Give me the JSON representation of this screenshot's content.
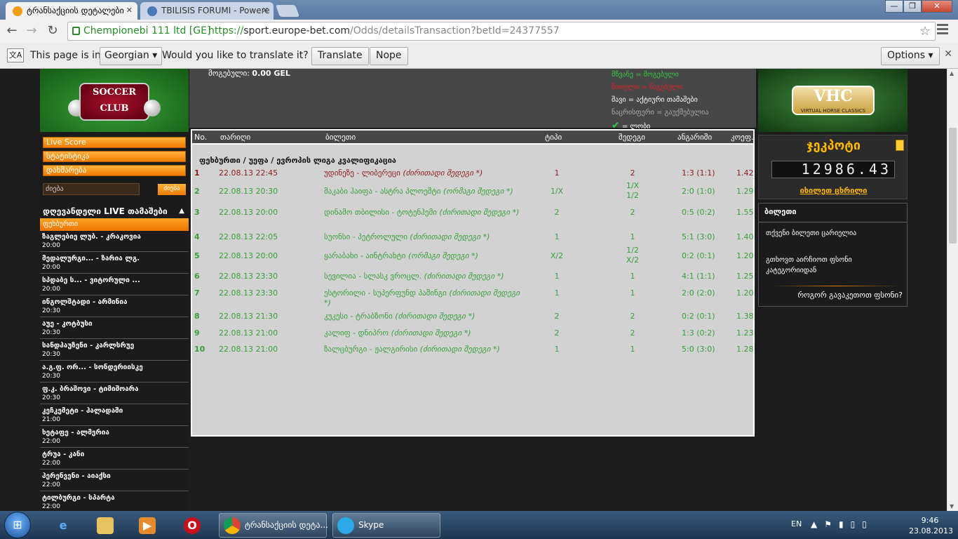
{
  "browser": {
    "tabs": [
      {
        "title": "ტრანსაქციის დეტალები",
        "active": true
      },
      {
        "title": "TBILISIS FORUMI - Powere",
        "active": false
      }
    ],
    "cert": "Chempionebi 111 ltd [GE]",
    "url_scheme": "https://",
    "url_host": "sport.europe-bet.com",
    "url_path": "/Odds/detailsTransaction?betId=24377557",
    "translate": {
      "prefix": "This page is in",
      "language": "Georgian",
      "question": "Would you like to translate it?",
      "translate_btn": "Translate",
      "nope_btn": "Nope",
      "options_btn": "Options"
    }
  },
  "left": {
    "menu": [
      "Live Score",
      "სტატისტიკა",
      "დახმარება"
    ],
    "search_placeholder": "ძიება",
    "search_btn": "ძიება",
    "live_title": "დღევანდელი LIVE თამაშები",
    "live_sport": "ფეხბურთი",
    "matches": [
      {
        "name": "ზაგლებიე ლუბ. - კრაკოვია",
        "time": "20:00"
      },
      {
        "name": "მედალურგი... - ზარია ლგ.",
        "time": "20:00"
      },
      {
        "name": "სპდაბე ს... - ვიტორული ...",
        "time": "20:00"
      },
      {
        "name": "ინგოლშტადი - არმინია",
        "time": "20:30"
      },
      {
        "name": "აუე - კოტბუსი",
        "time": "20:30"
      },
      {
        "name": "სანდჰაუზენი - კარლსრუე",
        "time": "20:30"
      },
      {
        "name": "ა.გ.ფ. ორ... - სონდერიისკე",
        "time": "20:30"
      },
      {
        "name": "ფ.კ. ბრაშოვი - ტიმიშოარა",
        "time": "20:30"
      },
      {
        "name": "კეჩკემეტი - ჰალადაში",
        "time": "21:00"
      },
      {
        "name": "ხეტაფე - ალმერია",
        "time": "22:00"
      },
      {
        "name": "ტრუა - კანი",
        "time": "22:00"
      },
      {
        "name": "ჰერენვენი - აიაქსი",
        "time": "22:00"
      },
      {
        "name": "ტილბურგი - სპარტა",
        "time": "22:00"
      }
    ]
  },
  "summary": {
    "won_label": "მოგებული:",
    "won_value": "0.00 GEL",
    "legend": {
      "green": "მწვანე = მოგებული",
      "red": "წითელი = წაგებული",
      "black": "შავი = აქტიური თამაშები",
      "gray": "ნაცრისფერი = გაუქმებულია",
      "check": "= ლობი"
    }
  },
  "table": {
    "headers": [
      "No.",
      "თარიღი",
      "ბილეთი",
      "ტიპი",
      "შედეგი",
      "ანგარიში",
      "კოეფ."
    ],
    "section": "ფეხბურთი / უეფა / ევროპის ლიგა კვალიფიკაცია",
    "rows": [
      {
        "no": "1",
        "date": "22.08.13 22:45",
        "match": "უდინეზე - ლიბერეცი",
        "market": "(ძირითადი შედეგი *)",
        "type": "1",
        "result": "2",
        "score": "1:3 (1:1)",
        "odd": "1.42",
        "status": "lost"
      },
      {
        "no": "2",
        "date": "22.08.13 20:30",
        "match": "მაკაბი ჰაიფა - ასტრა პლოეშტი",
        "market": "(ორმაგი შედეგი *)",
        "type": "1/X",
        "result": "1/X\n1/2",
        "score": "2:0 (1:0)",
        "odd": "1.29",
        "status": "won"
      },
      {
        "no": "3",
        "date": "22.08.13 20:00",
        "match": "დინამო თბილისი - ტოტენჰემი",
        "market": "(ძირითადი შედეგი *)",
        "type": "2",
        "result": "2",
        "score": "0:5 (0:2)",
        "odd": "1.55",
        "status": "won"
      },
      {
        "no": "4",
        "date": "22.08.13 22:05",
        "match": "სუონსი - პეტროლული",
        "market": "(ძირითადი შედეგი *)",
        "type": "1",
        "result": "1",
        "score": "5:1 (3:0)",
        "odd": "1.40",
        "status": "won"
      },
      {
        "no": "5",
        "date": "22.08.13 20:00",
        "match": "ყარაბახი - აინტრახტი",
        "market": "(ორმაგი შედეგი *)",
        "type": "X/2",
        "result": "1/2\nX/2",
        "score": "0:2 (0:1)",
        "odd": "1.20",
        "status": "won"
      },
      {
        "no": "6",
        "date": "22.08.13 23:30",
        "match": "სევილია - სლასკ ვროცლ.",
        "market": "(ძირითადი შედეგი *)",
        "type": "1",
        "result": "1",
        "score": "4:1 (1:1)",
        "odd": "1.25",
        "status": "won"
      },
      {
        "no": "7",
        "date": "22.08.13 23:30",
        "match": "ესტორილი - სუპერფუნდ პაშინგი",
        "market": "(ძირითადი შედეგი *)",
        "type": "1",
        "result": "1",
        "score": "2:0 (2:0)",
        "odd": "1.20",
        "status": "won"
      },
      {
        "no": "8",
        "date": "22.08.13 21:30",
        "match": "კუკესი - ტრაბზონი",
        "market": "(ძირითადი შედეგი *)",
        "type": "2",
        "result": "2",
        "score": "0:2 (0:1)",
        "odd": "1.38",
        "status": "won"
      },
      {
        "no": "9",
        "date": "22.08.13 21:00",
        "match": "კალიფ - დნიპრო",
        "market": "(ძირითადი შედეგი *)",
        "type": "2",
        "result": "2",
        "score": "1:3 (0:2)",
        "odd": "1.23",
        "status": "won"
      },
      {
        "no": "10",
        "date": "22.08.13 21:00",
        "match": "ზალცბურგი - ჟალგირისი",
        "market": "(ძირითადი შედეგი *)",
        "type": "1",
        "result": "1",
        "score": "5:0 (3:0)",
        "odd": "1.28",
        "status": "won"
      }
    ]
  },
  "right": {
    "vhc_title": "VHC",
    "vhc_sub": "VIRTUAL HORSE CLASSICS",
    "jackpot_title": "ჯეკპოტი",
    "jackpot_value": "12986.43",
    "jackpot_link": "იხილეთ ცხრილი",
    "ticket_title": "ბილეთი",
    "ticket_empty": "თქვენი ბილეთი ცარიელია",
    "ticket_choose": "გთხოვთ აირჩიოთ ფსონი კატეგორიიდან",
    "ticket_howto": "როგორ გავაკეთოთ ფსონი?"
  },
  "taskbar": {
    "tasks": [
      "ტრანსაქციის დეტა...",
      "Skype"
    ],
    "lang": "EN",
    "time": "9:46",
    "date": "23.08.2013"
  }
}
